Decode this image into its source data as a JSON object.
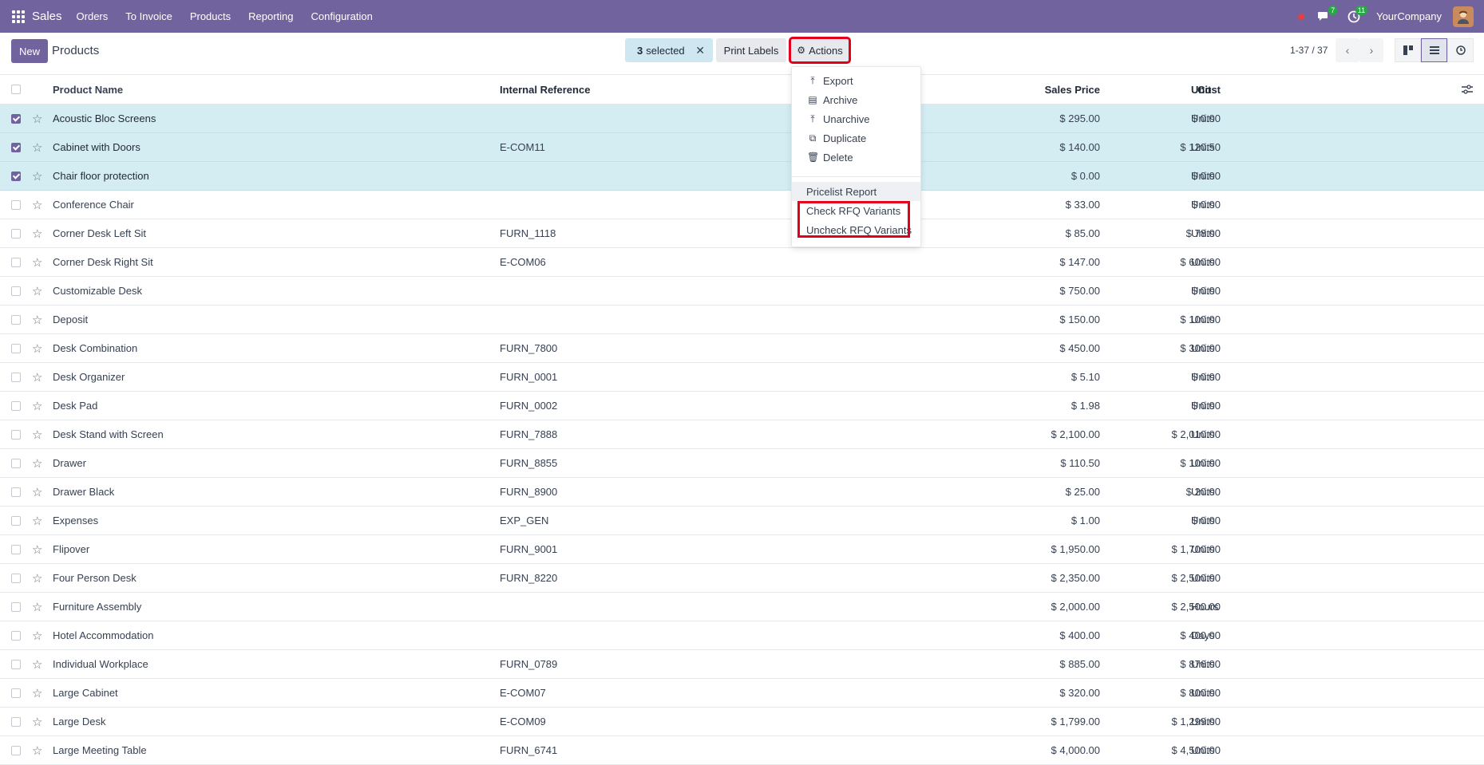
{
  "navbar": {
    "app_name": "Sales",
    "menu": [
      "Orders",
      "To Invoice",
      "Products",
      "Reporting",
      "Configuration"
    ],
    "messages_count": "7",
    "activities_count": "11",
    "company": "YourCompany"
  },
  "control": {
    "new_label": "New",
    "title": "Products",
    "selected_count": "3",
    "selected_text": "selected",
    "print_label": "Print Labels",
    "actions_label": "Actions",
    "pager": "1-37 / 37"
  },
  "table": {
    "headers": {
      "name": "Product Name",
      "ref": "Internal Reference",
      "price": "Sales Price",
      "cost": "Cost",
      "unit": "Unit"
    },
    "rows": [
      {
        "name": "Acoustic Bloc Screens",
        "ref": "",
        "price": "$ 295.00",
        "cost": "$ 0.00",
        "unit": "Units",
        "selected": true
      },
      {
        "name": "Cabinet with Doors",
        "ref": "E-COM11",
        "price": "$ 140.00",
        "cost": "$ 120.50",
        "unit": "Units",
        "selected": true
      },
      {
        "name": "Chair floor protection",
        "ref": "",
        "price": "$ 0.00",
        "cost": "$ 0.00",
        "unit": "Units",
        "selected": true
      },
      {
        "name": "Conference Chair",
        "ref": "",
        "price": "$ 33.00",
        "cost": "$ 0.00",
        "unit": "Units",
        "selected": false
      },
      {
        "name": "Corner Desk Left Sit",
        "ref": "FURN_1118",
        "price": "$ 85.00",
        "cost": "$ 78.00",
        "unit": "Units",
        "selected": false
      },
      {
        "name": "Corner Desk Right Sit",
        "ref": "E-COM06",
        "price": "$ 147.00",
        "cost": "$ 600.00",
        "unit": "Units",
        "selected": false
      },
      {
        "name": "Customizable Desk",
        "ref": "",
        "price": "$ 750.00",
        "cost": "$ 0.00",
        "unit": "Units",
        "selected": false
      },
      {
        "name": "Deposit",
        "ref": "",
        "price": "$ 150.00",
        "cost": "$ 100.00",
        "unit": "Units",
        "selected": false
      },
      {
        "name": "Desk Combination",
        "ref": "FURN_7800",
        "price": "$ 450.00",
        "cost": "$ 300.00",
        "unit": "Units",
        "selected": false
      },
      {
        "name": "Desk Organizer",
        "ref": "FURN_0001",
        "price": "$ 5.10",
        "cost": "$ 0.00",
        "unit": "Units",
        "selected": false
      },
      {
        "name": "Desk Pad",
        "ref": "FURN_0002",
        "price": "$ 1.98",
        "cost": "$ 0.00",
        "unit": "Units",
        "selected": false
      },
      {
        "name": "Desk Stand with Screen",
        "ref": "FURN_7888",
        "price": "$ 2,100.00",
        "cost": "$ 2,010.00",
        "unit": "Units",
        "selected": false
      },
      {
        "name": "Drawer",
        "ref": "FURN_8855",
        "price": "$ 110.50",
        "cost": "$ 100.00",
        "unit": "Units",
        "selected": false
      },
      {
        "name": "Drawer Black",
        "ref": "FURN_8900",
        "price": "$ 25.00",
        "cost": "$ 20.00",
        "unit": "Units",
        "selected": false
      },
      {
        "name": "Expenses",
        "ref": "EXP_GEN",
        "price": "$ 1.00",
        "cost": "$ 0.00",
        "unit": "Units",
        "selected": false
      },
      {
        "name": "Flipover",
        "ref": "FURN_9001",
        "price": "$ 1,950.00",
        "cost": "$ 1,700.00",
        "unit": "Units",
        "selected": false
      },
      {
        "name": "Four Person Desk",
        "ref": "FURN_8220",
        "price": "$ 2,350.00",
        "cost": "$ 2,500.00",
        "unit": "Units",
        "selected": false
      },
      {
        "name": "Furniture Assembly",
        "ref": "",
        "price": "$ 2,000.00",
        "cost": "$ 2,500.00",
        "unit": "Hours",
        "selected": false
      },
      {
        "name": "Hotel Accommodation",
        "ref": "",
        "price": "$ 400.00",
        "cost": "$ 400.00",
        "unit": "Days",
        "selected": false
      },
      {
        "name": "Individual Workplace",
        "ref": "FURN_0789",
        "price": "$ 885.00",
        "cost": "$ 876.00",
        "unit": "Units",
        "selected": false
      },
      {
        "name": "Large Cabinet",
        "ref": "E-COM07",
        "price": "$ 320.00",
        "cost": "$ 800.00",
        "unit": "Units",
        "selected": false
      },
      {
        "name": "Large Desk",
        "ref": "E-COM09",
        "price": "$ 1,799.00",
        "cost": "$ 1,299.00",
        "unit": "Units",
        "selected": false
      },
      {
        "name": "Large Meeting Table",
        "ref": "FURN_6741",
        "price": "$ 4,000.00",
        "cost": "$ 4,500.00",
        "unit": "Units",
        "selected": false
      }
    ]
  },
  "actions_menu": {
    "items": [
      {
        "label": "Export",
        "icon": "upload-icon"
      },
      {
        "label": "Archive",
        "icon": "archive-icon"
      },
      {
        "label": "Unarchive",
        "icon": "unarchive-icon"
      },
      {
        "label": "Duplicate",
        "icon": "copy-icon"
      },
      {
        "label": "Delete",
        "icon": "trash-icon"
      }
    ],
    "pricelist": "Pricelist Report",
    "check_rfq": "Check RFQ Variants",
    "uncheck_rfq": "Uncheck RFQ Variants"
  }
}
